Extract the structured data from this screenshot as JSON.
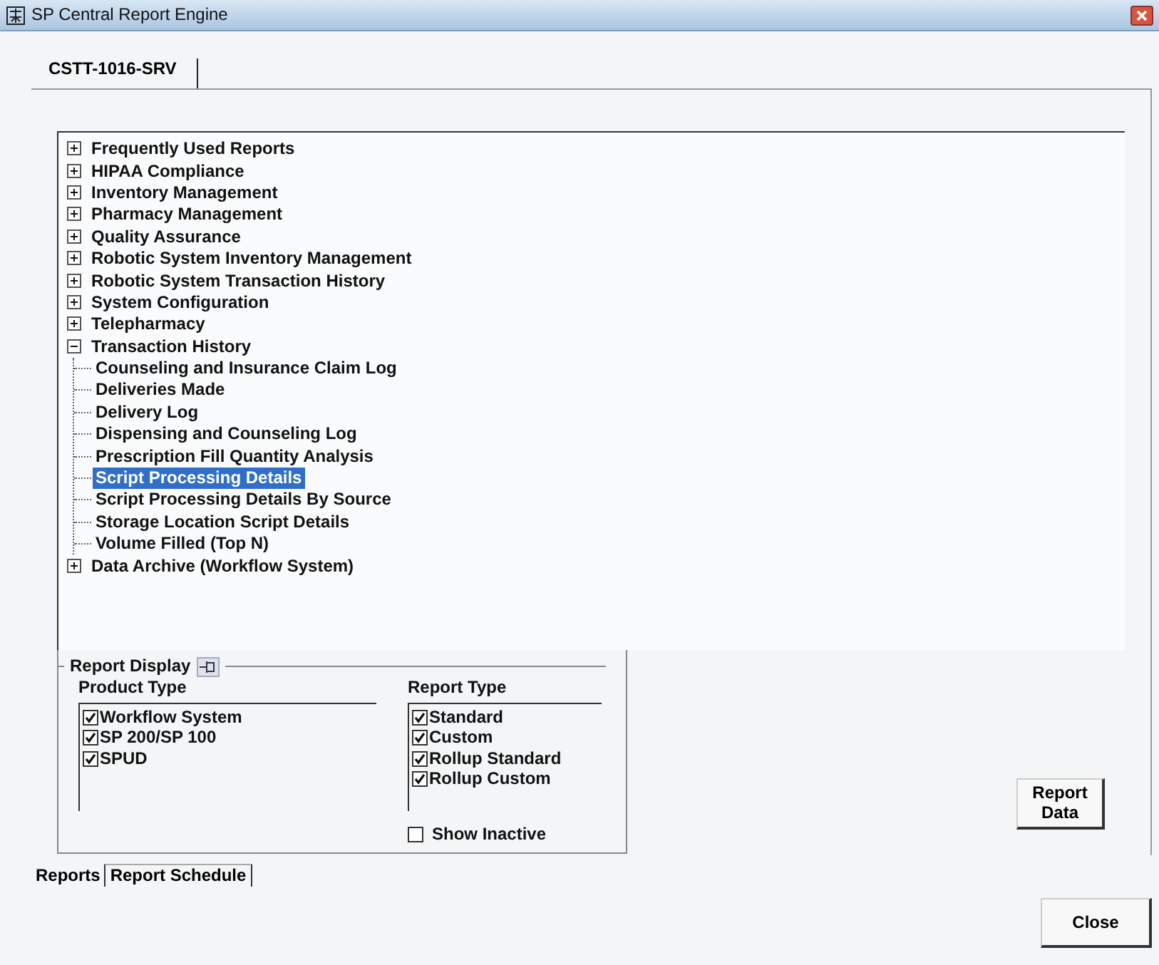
{
  "window": {
    "title": "SP Central Report Engine"
  },
  "server_tabs": [
    {
      "label": "CSTT-1016-SRV",
      "selected": true
    }
  ],
  "report_tree": [
    {
      "label": "Frequently Used Reports",
      "expanded": false
    },
    {
      "label": "HIPAA Compliance",
      "expanded": false
    },
    {
      "label": "Inventory Management",
      "expanded": false
    },
    {
      "label": "Pharmacy Management",
      "expanded": false
    },
    {
      "label": "Quality Assurance",
      "expanded": false
    },
    {
      "label": "Robotic System Inventory Management",
      "expanded": false
    },
    {
      "label": "Robotic System Transaction History",
      "expanded": false
    },
    {
      "label": "System Configuration",
      "expanded": false
    },
    {
      "label": "Telepharmacy",
      "expanded": false
    },
    {
      "label": "Transaction History",
      "expanded": true,
      "children": [
        {
          "label": "Counseling and Insurance Claim Log",
          "selected": false
        },
        {
          "label": "Deliveries Made",
          "selected": false
        },
        {
          "label": "Delivery Log",
          "selected": false
        },
        {
          "label": "Dispensing and Counseling Log",
          "selected": false
        },
        {
          "label": "Prescription Fill Quantity Analysis",
          "selected": false
        },
        {
          "label": "Script Processing Details",
          "selected": true
        },
        {
          "label": "Script Processing Details By Source",
          "selected": false
        },
        {
          "label": "Storage Location Script Details",
          "selected": false
        },
        {
          "label": "Volume Filled (Top N)",
          "selected": false
        }
      ]
    },
    {
      "label": "Data Archive (Workflow System)",
      "expanded": false
    }
  ],
  "report_display": {
    "title": "Report Display",
    "product_type": {
      "heading": "Product Type",
      "items": [
        {
          "label": "Workflow System",
          "checked": true
        },
        {
          "label": "SP 200/SP 100",
          "checked": true
        },
        {
          "label": "SPUD",
          "checked": true
        }
      ]
    },
    "report_type": {
      "heading": "Report Type",
      "items": [
        {
          "label": "Standard",
          "checked": true
        },
        {
          "label": "Custom",
          "checked": true
        },
        {
          "label": "Rollup Standard",
          "checked": true
        },
        {
          "label": "Rollup Custom",
          "checked": true
        }
      ]
    },
    "show_inactive": {
      "label": "Show Inactive",
      "checked": false
    }
  },
  "report_data_button": "Report Data",
  "bottom_tabs": [
    {
      "label": "Reports",
      "selected": true
    },
    {
      "label": "Report Schedule",
      "selected": false
    }
  ],
  "close_button": "Close"
}
